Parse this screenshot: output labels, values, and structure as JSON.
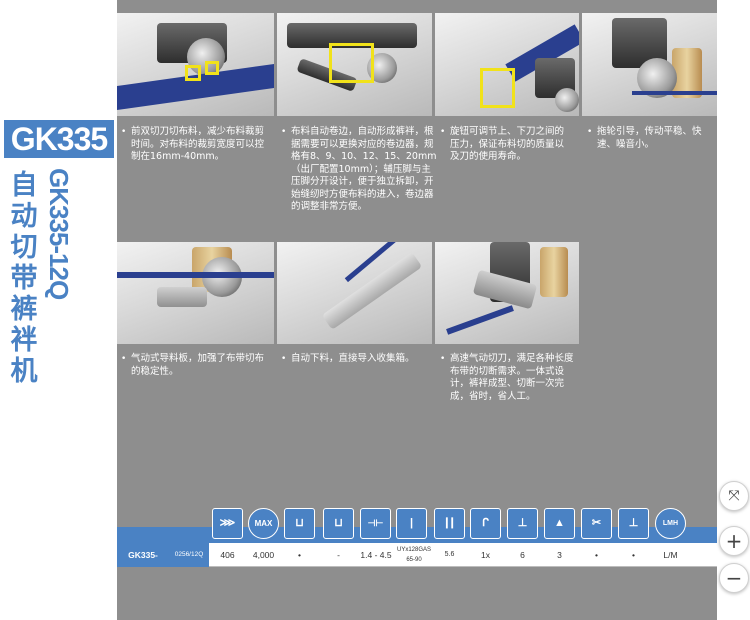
{
  "brand": "GK335",
  "model_vertical": "GK335-12Q",
  "title_cn": [
    "自",
    "动",
    "切",
    "带",
    "裤",
    "袢",
    "机"
  ],
  "features": [
    {
      "text": "前双切刀切布料，减少布料裁剪时间。对布料的裁剪宽度可以控制在16mm-40mm。"
    },
    {
      "text": "布料自动卷边，自动形成裤袢，根据需要可以更换对应的卷边器，规格有8、9、10、12、15、20mm（出厂配置10mm）；辅压脚与主压脚分开设计，便于独立拆卸，开始缝纫时方便布料的进入，卷边器的调整非常方便。"
    },
    {
      "text": "旋钮可调节上、下刀之间的压力，保证布料切的质量以及刀的使用寿命。"
    },
    {
      "text": "拖轮引导，传动平稳、快速、噪音小。"
    },
    {
      "text": "气动式导料板，加强了布带切布的稳定性。"
    },
    {
      "text": "自动下料，直接导入收集箱。"
    },
    {
      "text": "高速气动切刀，满足各种长度布带的切断需求。一体式设计，裤袢成型、切断一次完成，省时，省人工。"
    }
  ],
  "spec_icons": [
    {
      "name": "stitch-pattern-icon",
      "glyph": "⋙"
    },
    {
      "name": "max-speed-icon",
      "glyph": "MAX"
    },
    {
      "name": "stitch-length-icon",
      "glyph": "⊔"
    },
    {
      "name": "differential-feed-icon",
      "glyph": "⊔"
    },
    {
      "name": "needle-distance-icon",
      "glyph": "⊣⊢"
    },
    {
      "name": "needle-gauge-icon",
      "glyph": "|"
    },
    {
      "name": "foot-lift-icon",
      "glyph": "┃┃"
    },
    {
      "name": "needle-type-icon",
      "glyph": "ᒋ"
    },
    {
      "name": "presser-foot-icon",
      "glyph": "⊥"
    },
    {
      "name": "thread-count-icon",
      "glyph": "▲"
    },
    {
      "name": "cutter-icon",
      "glyph": "✂"
    },
    {
      "name": "trimmer-icon",
      "glyph": "⊥"
    },
    {
      "name": "lubrication-icon",
      "glyph": "LMH"
    }
  ],
  "spec_row": {
    "model": "GK335-",
    "model_suffix": "0256/12Q",
    "stitch": "406",
    "max_speed": "4,000",
    "stitch_length": "•",
    "differential": "-",
    "needle_distance": "1.4 - 4.5",
    "needle_type_line1": "UYx128GAS",
    "needle_type_line2": "65-90",
    "needle_gauge": "5.6",
    "foot_lift": "1x",
    "needles": "6",
    "threads": "3",
    "cutter": "•",
    "trimmer": "•",
    "lubrication": "L/M"
  },
  "controls": {
    "fit": "⤧",
    "zoom_in": "+",
    "zoom_out": "−"
  },
  "colors": {
    "accent": "#4a82c4",
    "panel": "#8e8e8e",
    "highlight": "#f1e21a"
  }
}
